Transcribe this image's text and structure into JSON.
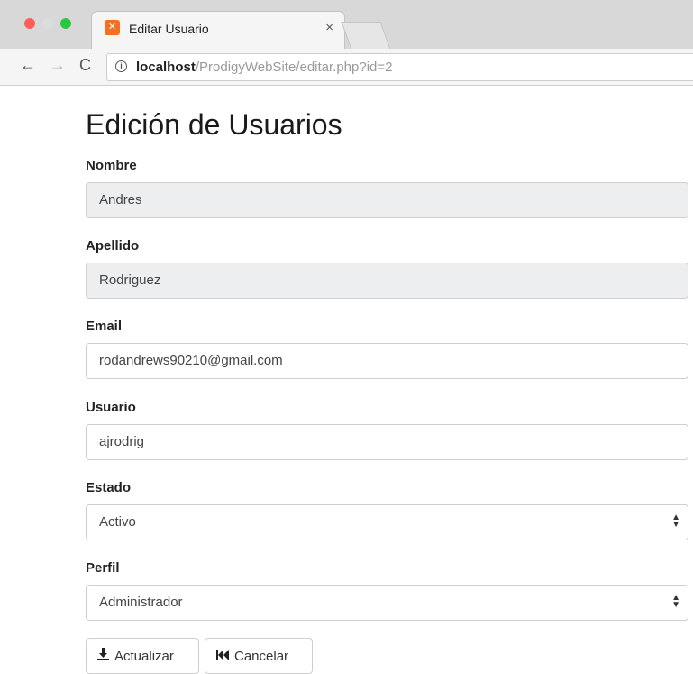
{
  "browser": {
    "tab_title": "Editar Usuario",
    "tab_icon": "xampp-icon",
    "tab_close": "×",
    "url_host": "localhost",
    "url_path": "/ProdigyWebSite/editar.php?id=2"
  },
  "page": {
    "title": "Edición de Usuarios"
  },
  "form": {
    "nombre": {
      "label": "Nombre",
      "value": "Andres",
      "readonly": true
    },
    "apellido": {
      "label": "Apellido",
      "value": "Rodriguez",
      "readonly": true
    },
    "email": {
      "label": "Email",
      "value": "rodandrews90210@gmail.com"
    },
    "usuario": {
      "label": "Usuario",
      "value": "ajrodrig"
    },
    "estado": {
      "label": "Estado",
      "value": "Activo"
    },
    "perfil": {
      "label": "Perfil",
      "value": "Administrador"
    }
  },
  "buttons": {
    "actualizar": {
      "label": "Actualizar",
      "icon": "download-icon"
    },
    "cancelar": {
      "label": "Cancelar",
      "icon": "fast-backward-icon"
    }
  },
  "colors": {
    "readonly_bg": "#eceeef",
    "border": "#cfcfcf",
    "tab_favicon": "#f36f21"
  }
}
